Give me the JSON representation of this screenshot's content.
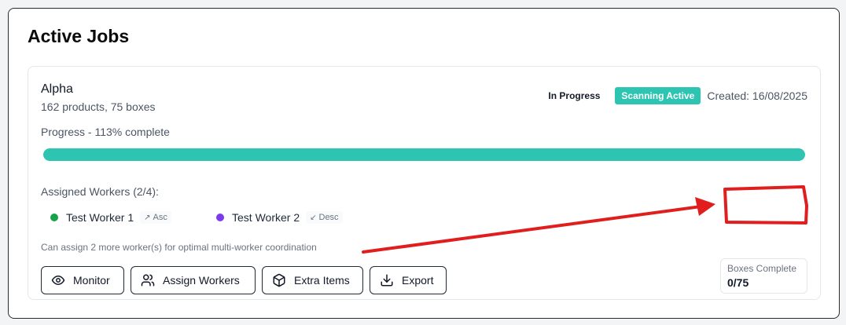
{
  "section": {
    "title": "Active Jobs"
  },
  "job": {
    "name": "Alpha",
    "summary": "162 products, 75 boxes",
    "status": "In Progress",
    "badge": "Scanning Active",
    "created": "Created: 16/08/2025",
    "progress_label": "Progress - 113% complete",
    "progress_percent": 113,
    "workers_label": "Assigned Workers (2/4):",
    "workers": [
      {
        "name": "Test Worker 1",
        "sort": "Asc",
        "color": "#16a34a",
        "sort_icon": "arrow-up-right-icon"
      },
      {
        "name": "Test Worker 2",
        "sort": "Desc",
        "color": "#7c3aed",
        "sort_icon": "arrow-down-right-icon"
      }
    ],
    "hint": "Can assign 2 more worker(s) for optimal multi-worker coordination",
    "actions": {
      "monitor": "Monitor",
      "assign": "Assign Workers",
      "extra": "Extra Items",
      "export": "Export"
    },
    "boxes": {
      "label": "Boxes Complete",
      "value": "0/75"
    }
  },
  "colors": {
    "accent": "#2dc4b2",
    "annotation": "#e01e1e"
  }
}
